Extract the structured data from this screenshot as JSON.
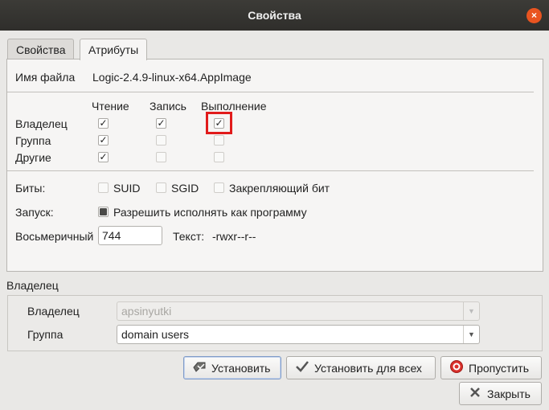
{
  "window": {
    "title": "Свойства",
    "close_glyph": "×"
  },
  "tabs": [
    {
      "label": "Свойства",
      "active": false
    },
    {
      "label": "Атрибуты",
      "active": true
    }
  ],
  "file": {
    "label": "Имя файла",
    "value": "Logic-2.4.9-linux-x64.AppImage"
  },
  "permissions": {
    "columns": {
      "read": "Чтение",
      "write": "Запись",
      "exec": "Выполнение"
    },
    "rows": [
      {
        "label": "Владелец",
        "read": true,
        "write": true,
        "exec": true
      },
      {
        "label": "Группа",
        "read": true,
        "write": false,
        "exec": false
      },
      {
        "label": "Другие",
        "read": true,
        "write": false,
        "exec": false
      }
    ]
  },
  "bits": {
    "label": "Биты:",
    "suid": "SUID",
    "sgid": "SGID",
    "sticky": "Закрепляющий бит"
  },
  "launch": {
    "label": "Запуск:",
    "checkbox_label": "Разрешить исполнять как программу",
    "state": "mixed"
  },
  "octal": {
    "label": "Восьмеричный",
    "value": "744",
    "text_label": "Текст:",
    "text_value": "-rwxr--r--"
  },
  "owner_section": {
    "title": "Владелец",
    "owner_label": "Владелец",
    "owner_value": "apsinyutki",
    "group_label": "Группа",
    "group_value": "domain users"
  },
  "buttons": {
    "apply": "Установить",
    "apply_all": "Установить для всех",
    "skip": "Пропустить",
    "close": "Закрыть"
  },
  "colors": {
    "accent_close": "#e95420",
    "highlight": "#e11b1b",
    "titlebar": "#3c3b37"
  },
  "icons": [
    "close-icon",
    "checkmark-icon",
    "apply-icon",
    "skip-icon",
    "close-x-icon",
    "dropdown-arrow-icon"
  ]
}
